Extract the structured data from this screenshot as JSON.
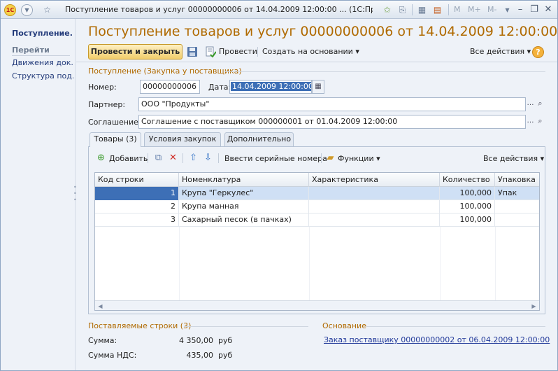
{
  "window": {
    "title": "Поступление товаров и услуг 00000000006 от 14.04.2009 12:00:00 ... (1С:Предприятие)",
    "logo_text": "1С",
    "m_buttons": [
      "M",
      "M+",
      "M-"
    ]
  },
  "left_panel": {
    "active": "Поступление...",
    "section_title": "Перейти",
    "links": [
      "Движения док...",
      "Структура под..."
    ]
  },
  "document": {
    "title": "Поступление товаров и услуг 00000000006 от 14.04.2009 12:00:00"
  },
  "toolbar": {
    "post_close": "Провести и закрыть",
    "post": "Провести",
    "create_based": "Создать на основании",
    "all_actions": "Все действия",
    "help": "?"
  },
  "header_group": {
    "title": "Поступление (Закупка у поставщика)",
    "number_label": "Номер:",
    "number_value": "00000000006",
    "date_label": "Дата:",
    "date_value": "14.04.2009 12:00:00",
    "partner_label": "Партнер:",
    "partner_value": "ООО \"Продукты\"",
    "agreement_label": "Соглашение:",
    "agreement_value": "Соглашение с поставщиком 000000001 от 01.04.2009 12:00:00"
  },
  "tabs": [
    "Товары (3)",
    "Условия закупок",
    "Дополнительно"
  ],
  "goods_toolbar": {
    "add": "Добавить",
    "serials": "Ввести серийные номера",
    "functions": "Функции",
    "all_actions": "Все действия"
  },
  "table": {
    "columns": [
      "Код строки",
      "Номенклатура",
      "Характеристика",
      "Количество",
      "Упаковка"
    ],
    "rows": [
      {
        "code": "1",
        "item": "Крупа \"Геркулес\"",
        "feature": "",
        "qty": "100,000",
        "pack": "Упак"
      },
      {
        "code": "2",
        "item": "Крупа манная",
        "feature": "",
        "qty": "100,000",
        "pack": ""
      },
      {
        "code": "3",
        "item": "Сахарный песок (в пачках)",
        "feature": "",
        "qty": "100,000",
        "pack": ""
      }
    ]
  },
  "totals": {
    "title": "Поставляемые строки (3)",
    "sum_label": "Сумма:",
    "sum_value": "4 350,00",
    "sum_currency": "руб",
    "vat_label": "Сумма НДС:",
    "vat_value": "435,00",
    "vat_currency": "руб"
  },
  "basis": {
    "title": "Основание",
    "link": "Заказ поставщику 00000000002 от 06.04.2009 12:00:00"
  },
  "colors": {
    "title_accent": "#b06a00",
    "link": "#223a7a",
    "selection": "#3d6fb6"
  }
}
